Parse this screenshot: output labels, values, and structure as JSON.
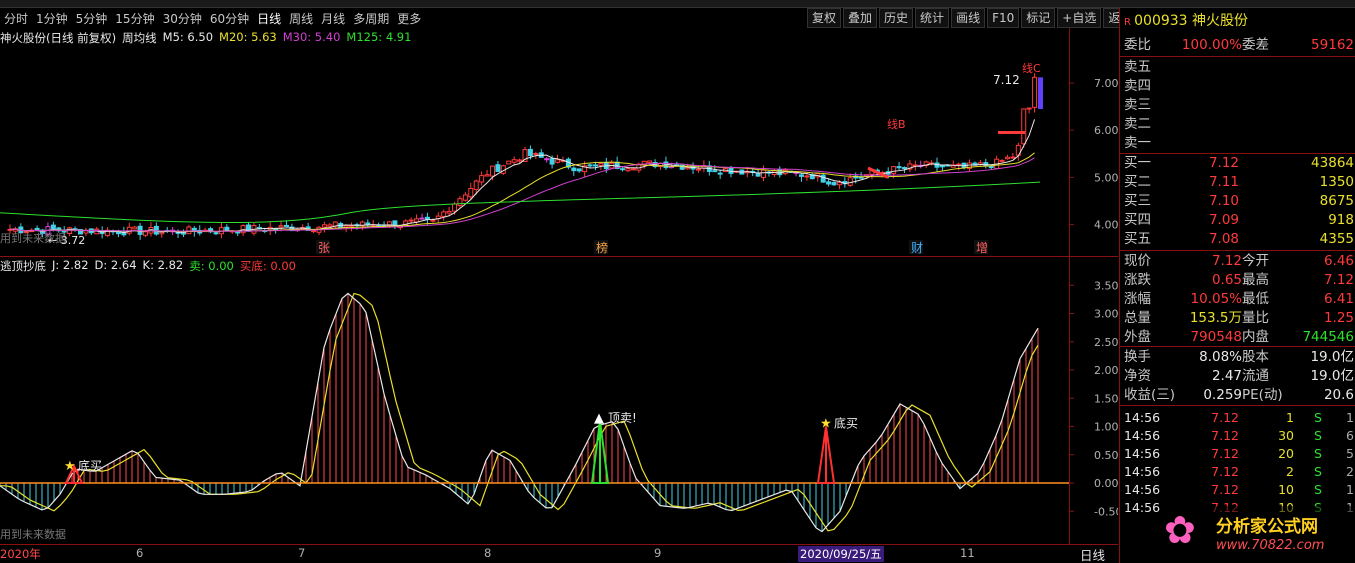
{
  "toolbar": {
    "timeframes": [
      "分时",
      "1分钟",
      "5分钟",
      "15分钟",
      "30分钟",
      "60分钟",
      "日线",
      "周线",
      "月线",
      "多周期",
      "更多"
    ],
    "active": "日线",
    "tools": [
      "复权",
      "叠加",
      "历史",
      "统计",
      "画线",
      "F10",
      "标记",
      "+自选",
      "返回"
    ]
  },
  "main_panel": {
    "title": "神火股份(日线 前复权)",
    "ma_label": "周均线",
    "ma": [
      {
        "name": "M5:",
        "value": "6.50",
        "color": "#e8e8e8"
      },
      {
        "name": "M20:",
        "value": "5.63",
        "color": "#e8e02a"
      },
      {
        "name": "M30:",
        "value": "5.40",
        "color": "#d040d0"
      },
      {
        "name": "M125:",
        "value": "4.91",
        "color": "#2ee02e"
      }
    ],
    "price_axis": [
      "7.00",
      "6.00",
      "5.00",
      "4.00"
    ],
    "markers": [
      "张",
      "榜",
      "财",
      "增"
    ],
    "price_label_high": "7.12",
    "price_label_low": "3.72",
    "line_b": "线B",
    "line_c": "线C",
    "future_note": "用到未来数据"
  },
  "ind_panel": {
    "title": "逃顶抄底",
    "j": "J: 2.82",
    "d": "D: 2.64",
    "k": "K: 2.82",
    "sell": "卖: 0.00",
    "buy": "买底: 0.00",
    "axis": [
      "3.50",
      "3.00",
      "2.50",
      "2.00",
      "1.50",
      "1.00",
      "0.50",
      "0.00",
      "-0.50"
    ],
    "signals": [
      "底买",
      "顶卖!",
      "底买"
    ],
    "future_note": "用到未来数据"
  },
  "date_axis": {
    "labels": [
      "2020年",
      "6",
      "7",
      "8",
      "9",
      "2020/09/25/五",
      "11"
    ],
    "period": "日线"
  },
  "quote": {
    "code": "000933",
    "name": "神火股份",
    "wb_label": "委比",
    "wb": "100.00%",
    "wc_label": "委差",
    "wc": "59162",
    "sells": [
      {
        "l": "卖五",
        "p": "",
        "v": ""
      },
      {
        "l": "卖四",
        "p": "",
        "v": ""
      },
      {
        "l": "卖三",
        "p": "",
        "v": ""
      },
      {
        "l": "卖二",
        "p": "",
        "v": ""
      },
      {
        "l": "卖一",
        "p": "",
        "v": ""
      }
    ],
    "buys": [
      {
        "l": "买一",
        "p": "7.12",
        "v": "43864"
      },
      {
        "l": "买二",
        "p": "7.11",
        "v": "1350"
      },
      {
        "l": "买三",
        "p": "7.10",
        "v": "8675"
      },
      {
        "l": "买四",
        "p": "7.09",
        "v": "918"
      },
      {
        "l": "买五",
        "p": "7.08",
        "v": "4355"
      }
    ],
    "stats": [
      {
        "l": "现价",
        "v": "7.12",
        "c": "red",
        "l2": "今开",
        "v2": "6.46",
        "c2": "red"
      },
      {
        "l": "涨跌",
        "v": "0.65",
        "c": "red",
        "l2": "最高",
        "v2": "7.12",
        "c2": "red"
      },
      {
        "l": "涨幅",
        "v": "10.05%",
        "c": "red",
        "l2": "最低",
        "v2": "6.41",
        "c2": "red"
      },
      {
        "l": "总量",
        "v": "153.5万",
        "c": "yel",
        "l2": "量比",
        "v2": "1.25",
        "c2": "red"
      },
      {
        "l": "外盘",
        "v": "790548",
        "c": "red",
        "l2": "内盘",
        "v2": "744546",
        "c2": "grn"
      }
    ],
    "stats2": [
      {
        "l": "换手",
        "v": "8.08%",
        "l2": "股本",
        "v2": "19.0亿"
      },
      {
        "l": "净资",
        "v": "2.47",
        "l2": "流通",
        "v2": "19.0亿"
      },
      {
        "l": "收益(三)",
        "v": "0.259",
        "l2": "PE(动)",
        "v2": "20.6"
      }
    ],
    "ticks": [
      {
        "t": "14:56",
        "p": "7.12",
        "v": "1",
        "s": "S",
        "n": "1"
      },
      {
        "t": "14:56",
        "p": "7.12",
        "v": "30",
        "s": "S",
        "n": "6"
      },
      {
        "t": "14:56",
        "p": "7.12",
        "v": "20",
        "s": "S",
        "n": "5"
      },
      {
        "t": "14:56",
        "p": "7.12",
        "v": "2",
        "s": "S",
        "n": "2"
      },
      {
        "t": "14:56",
        "p": "7.12",
        "v": "10",
        "s": "S",
        "n": "1"
      },
      {
        "t": "14:56",
        "p": "7.12",
        "v": "10",
        "s": "S",
        "n": "1"
      }
    ],
    "watermark": "分析家公式网",
    "watermark_url": "www.70822.com"
  }
}
